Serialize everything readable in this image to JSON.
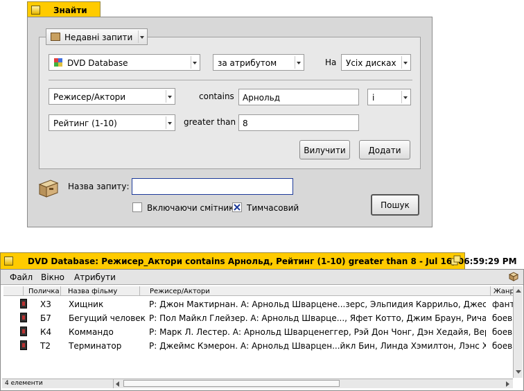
{
  "find_window": {
    "title": "Знайти",
    "recent_queries_label": "Недавні запити",
    "volume_menu": "DVD Database",
    "search_mode": "за атрибутом",
    "on_label": "На",
    "disk_menu": "Усіх дисках",
    "rows": [
      {
        "attribute": "Режисер/Актори",
        "operator": "contains",
        "value": "Арнольд",
        "combinator": "і"
      },
      {
        "attribute": "Рейтинг (1-10)",
        "operator": "greater than",
        "value": "8"
      }
    ],
    "remove_button": "Вилучити",
    "add_button": "Додати",
    "query_name_label": "Назва запиту:",
    "query_name_value": "",
    "include_trash_label": "Включаючи смітник",
    "include_trash_checked": false,
    "temporary_label": "Тимчасовий",
    "temporary_checked": true,
    "search_button": "Пошук"
  },
  "results_window": {
    "title": "DVD Database: Режисер_Актори contains Арнольд, Рейтинг (1-10) greater than 8 - Jul 16, 06:59:29 PM",
    "menu": [
      "Файл",
      "Вікно",
      "Атрибути"
    ],
    "columns": [
      "Поличка",
      "Назва фільму",
      "Режисер/Актори",
      "Жанр"
    ],
    "rows": [
      {
        "shelf": "Х3",
        "title": "Хищник",
        "cast": "Р: Джон Мактирнан. А: Арнольд Шварцене...зерс, Эльпидия Каррильо, Джесси Вентура",
        "genre": "фант"
      },
      {
        "shelf": "Б7",
        "title": "Бегущий человек",
        "cast": "Р: Пол Майкл Глейзер. А: Арнольд Шварце..., Яфет Котто, Джим Браун, Ричард Доусон",
        "genre": "боев"
      },
      {
        "shelf": "К4",
        "title": "Коммандо",
        "cast": "Р: Марк Л. Лестер. А: Арнольд Шварценеггер, Рэй Дон Чонг, Дэн Хедайя, Вернон Уэллс",
        "genre": "боев"
      },
      {
        "shelf": "Т2",
        "title": "Терминатор",
        "cast": "Р: Джеймс Кэмерон. А: Арнольд Шварцен...йкл Бин, Линда Хэмилтон, Лэнс Хенриксен",
        "genre": "боев"
      }
    ],
    "status": "4 елементи"
  }
}
